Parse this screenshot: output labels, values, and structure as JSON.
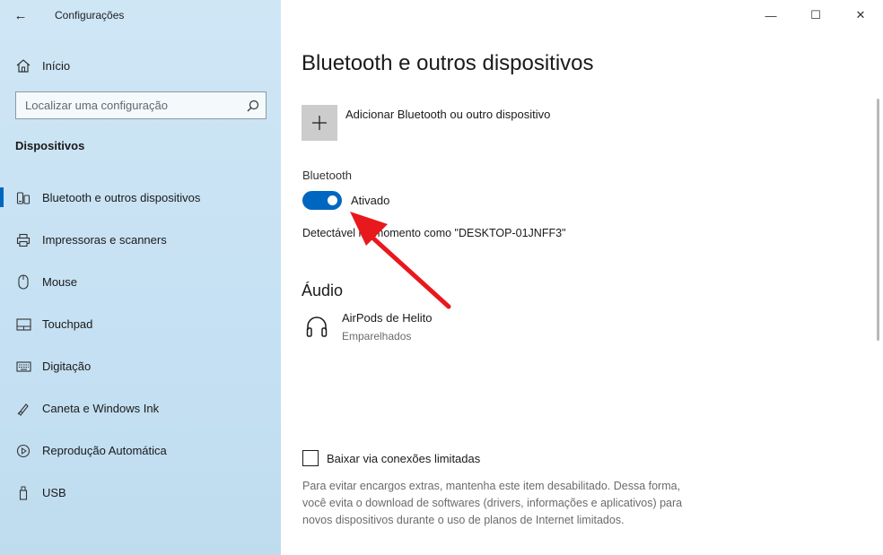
{
  "window": {
    "title": "Configurações",
    "controls": {
      "minimize": "—",
      "maximize": "☐",
      "close": "✕"
    }
  },
  "sidebar": {
    "home_label": "Início",
    "search_placeholder": "Localizar uma configuração",
    "section_title": "Dispositivos",
    "items": [
      {
        "label": "Bluetooth e outros dispositivos",
        "icon": "bluetooth-devices-icon",
        "active": true
      },
      {
        "label": "Impressoras e scanners",
        "icon": "printer-icon",
        "active": false
      },
      {
        "label": "Mouse",
        "icon": "mouse-icon",
        "active": false
      },
      {
        "label": "Touchpad",
        "icon": "touchpad-icon",
        "active": false
      },
      {
        "label": "Digitação",
        "icon": "keyboard-icon",
        "active": false
      },
      {
        "label": "Caneta e Windows Ink",
        "icon": "pen-icon",
        "active": false
      },
      {
        "label": "Reprodução Automática",
        "icon": "autoplay-icon",
        "active": false
      },
      {
        "label": "USB",
        "icon": "usb-icon",
        "active": false
      }
    ]
  },
  "main": {
    "page_title": "Bluetooth e outros dispositivos",
    "add_device_label": "Adicionar Bluetooth ou outro dispositivo",
    "bluetooth": {
      "label": "Bluetooth",
      "toggle_state": "Ativado",
      "toggle_on": true,
      "discoverable_text": "Detectável no momento como \"DESKTOP-01JNFF3\""
    },
    "audio": {
      "section_title": "Áudio",
      "devices": [
        {
          "name": "AirPods de Helito",
          "status": "Emparelhados",
          "icon": "headphones-icon"
        }
      ]
    },
    "metered": {
      "label": "Baixar via conexões limitadas",
      "checked": false,
      "description": "Para evitar encargos extras, mantenha este item desabilitado. Dessa forma, você evita o download de softwares (drivers, informações e aplicativos) para novos dispositivos durante o uso de planos de Internet limitados."
    }
  },
  "colors": {
    "accent": "#0067c0",
    "sidebar_bg": "#c6e1f3",
    "annotation_arrow": "#e8181c"
  }
}
